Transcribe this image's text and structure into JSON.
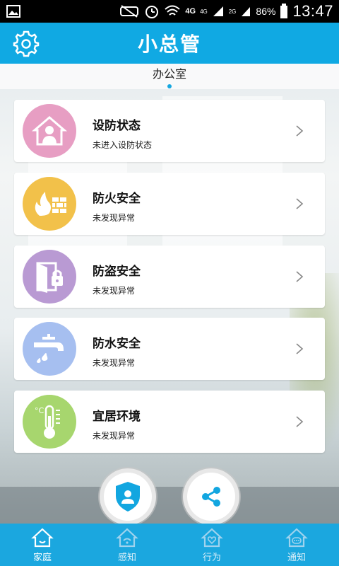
{
  "status_bar": {
    "battery_pct": "86%",
    "time": "13:47",
    "net_a": "4G",
    "net_b": "4G",
    "net_c": "2G",
    "icons": [
      "image-icon",
      "mute-icon",
      "alarm-icon",
      "wifi-icon",
      "signal-icon",
      "battery-icon"
    ]
  },
  "header": {
    "title": "小总管",
    "settings_icon": "gear-icon"
  },
  "subheader": {
    "location": "办公室"
  },
  "cards": [
    {
      "title": "设防状态",
      "status": "未进入设防状态",
      "icon": "house-person-icon",
      "color": "#e79ec3"
    },
    {
      "title": "防火安全",
      "status": "未发现异常",
      "icon": "fire-icon",
      "color": "#f2c14a"
    },
    {
      "title": "防盗安全",
      "status": "未发现异常",
      "icon": "door-lock-icon",
      "color": "#b99ad3"
    },
    {
      "title": "防水安全",
      "status": "未发现异常",
      "icon": "water-tap-icon",
      "color": "#a6bff0"
    },
    {
      "title": "宜居环境",
      "status": "未发现异常",
      "icon": "thermometer-icon",
      "color": "#a7d66e"
    }
  ],
  "fabs": [
    {
      "icon": "shield-person-icon"
    },
    {
      "icon": "share-icon"
    }
  ],
  "bottom_nav": {
    "tabs": [
      {
        "label": "家庭",
        "icon": "home-icon",
        "active": true
      },
      {
        "label": "感知",
        "icon": "sense-icon",
        "active": false
      },
      {
        "label": "行为",
        "icon": "heart-house-icon",
        "active": false
      },
      {
        "label": "通知",
        "icon": "notify-icon",
        "active": false
      }
    ]
  },
  "colors": {
    "accent": "#10a9e3",
    "nav": "#1ba7df",
    "fab_icon": "#12a6e0"
  }
}
